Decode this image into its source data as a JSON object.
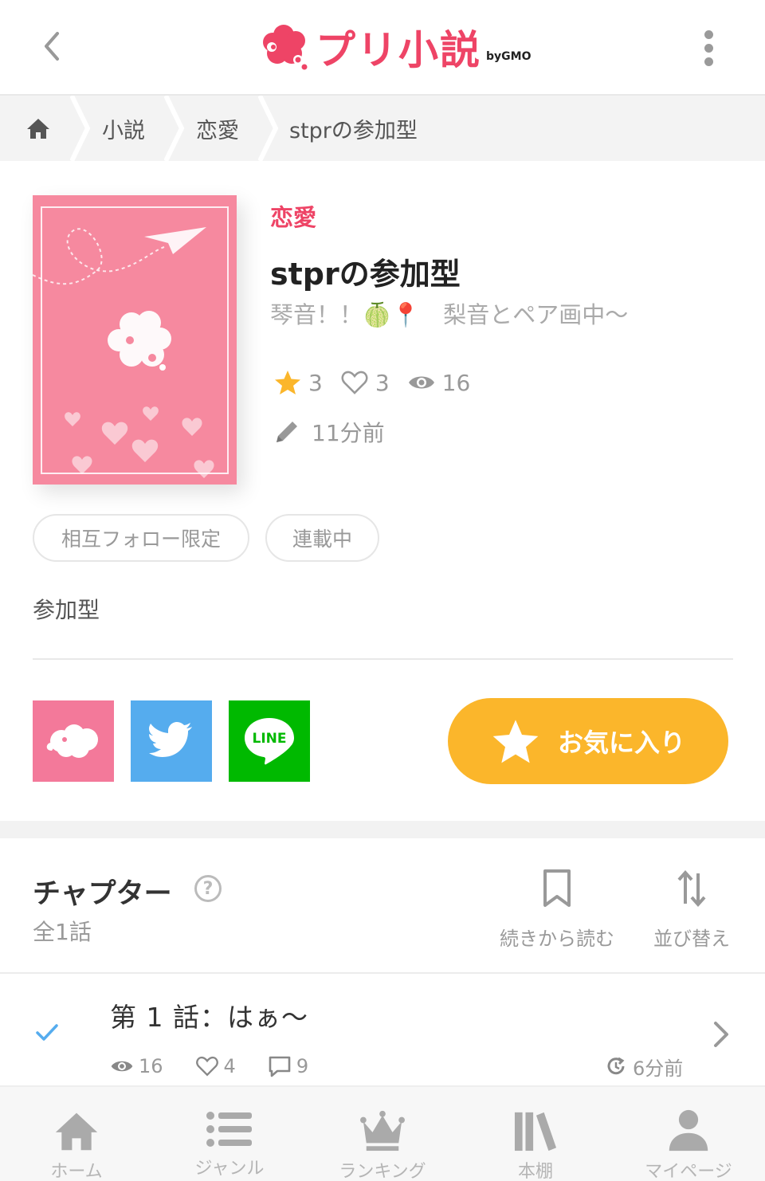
{
  "header": {
    "logo_text": "プリ小説",
    "logo_sub": "byGMO",
    "back_icon": "chevron-left-icon",
    "menu_icon": "kebab-menu-icon"
  },
  "breadcrumb": {
    "home_icon": "home-icon",
    "items": [
      "小説",
      "恋愛",
      "stprの参加型"
    ]
  },
  "book": {
    "genre": "恋愛",
    "title": "stprの参加型",
    "author": "琴音！！🍈📍　梨音とペア画中〜",
    "stars": "3",
    "likes": "3",
    "views": "16",
    "updated": "11分前",
    "tags": [
      "相互フォロー限定",
      "連載中"
    ],
    "description": "参加型"
  },
  "share": {
    "buttons": [
      "prichat-share",
      "twitter-share",
      "line-share"
    ],
    "line_label": "LINE",
    "favorite_label": "お気に入り"
  },
  "chapters": {
    "title": "チャプター",
    "help": "?",
    "count": "全1話",
    "continue_label": "続きから読む",
    "sort_label": "並び替え",
    "list": [
      {
        "title": "第 1 話：はぁ〜",
        "views": "16",
        "likes": "4",
        "comments": "9",
        "time": "6分前"
      }
    ]
  },
  "bottom_nav": {
    "items": [
      {
        "label": "ホーム",
        "icon": "home-icon"
      },
      {
        "label": "ジャンル",
        "icon": "list-icon"
      },
      {
        "label": "ランキング",
        "icon": "crown-icon"
      },
      {
        "label": "本棚",
        "icon": "bookshelf-icon"
      },
      {
        "label": "マイページ",
        "icon": "user-icon"
      }
    ]
  },
  "colors": {
    "brand": "#ee4466",
    "favorite": "#fbb62b",
    "twitter": "#55acee",
    "line": "#00b900",
    "prichat": "#f3799a",
    "cover": "#f6899f"
  }
}
